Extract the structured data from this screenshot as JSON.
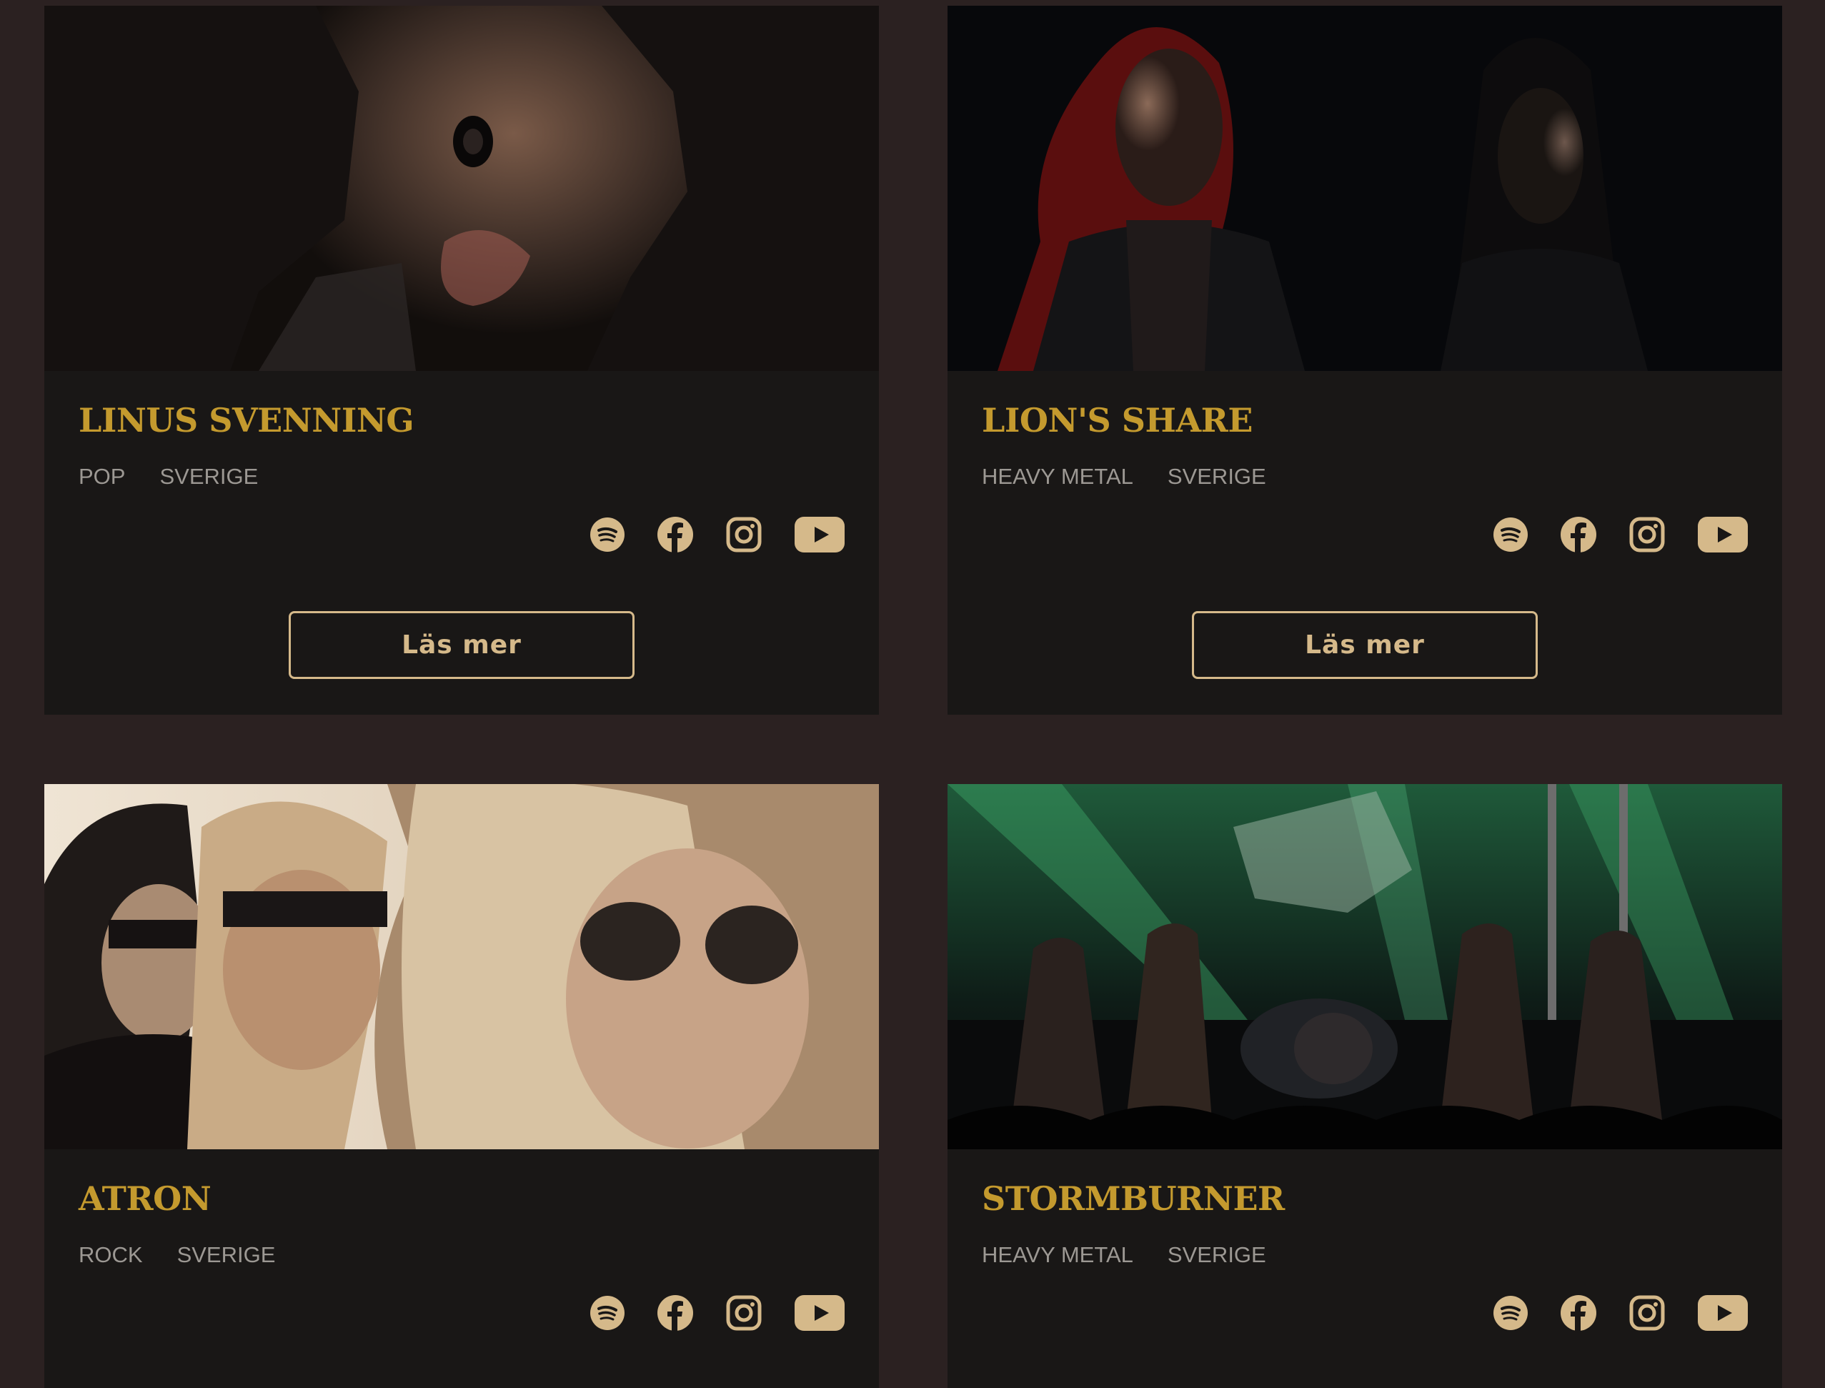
{
  "cards": [
    {
      "name": "LINUS SVENNING",
      "genre": "POP",
      "country": "SVERIGE",
      "button_label": "Läs mer",
      "photo_alt": ""
    },
    {
      "name": "LION'S SHARE",
      "genre": "HEAVY METAL",
      "country": "SVERIGE",
      "button_label": "Läs mer",
      "photo_alt": ""
    },
    {
      "name": "ATRON",
      "genre": "ROCK",
      "country": "SVERIGE"
    },
    {
      "name": "STORMBURNER",
      "genre": "HEAVY METAL",
      "country": "SVERIGE"
    }
  ],
  "socials": [
    "spotify-icon",
    "facebook-icon",
    "instagram-icon",
    "youtube-icon"
  ],
  "colors": {
    "page_background": "#2b2121",
    "card_background": "#191716",
    "name_gold": "#c49a2e",
    "tag_gray": "#9c9893",
    "icon_beige": "#d5b98a"
  }
}
